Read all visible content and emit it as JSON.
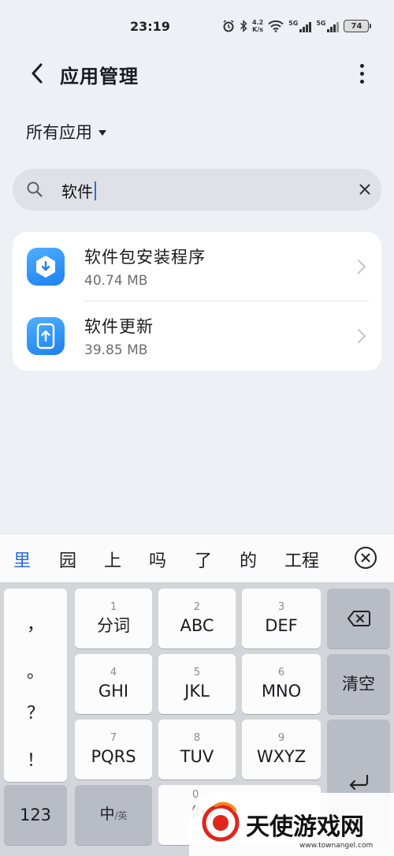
{
  "status_bar": {
    "time": "23:19",
    "net_speed_value": "4.2",
    "net_speed_unit": "K/s",
    "sim1_label": "5G",
    "sim2_label": "5G",
    "battery_level": "74"
  },
  "header": {
    "title": "应用管理"
  },
  "filter": {
    "label": "所有应用"
  },
  "search": {
    "value": "软件"
  },
  "results": [
    {
      "name": "软件包安装程序",
      "size": "40.74 MB",
      "icon": "package-installer-icon"
    },
    {
      "name": "软件更新",
      "size": "39.85 MB",
      "icon": "software-update-icon"
    }
  ],
  "candidates": [
    "里",
    "园",
    "上",
    "吗",
    "了",
    "的",
    "工程"
  ],
  "keyboard": {
    "punctuation": [
      "，",
      "。",
      "？",
      "！"
    ],
    "keys": [
      {
        "num": "1",
        "label": "分词"
      },
      {
        "num": "2",
        "label": "ABC"
      },
      {
        "num": "3",
        "label": "DEF"
      },
      {
        "num": "4",
        "label": "GHI"
      },
      {
        "num": "5",
        "label": "JKL"
      },
      {
        "num": "6",
        "label": "MNO"
      },
      {
        "num": "7",
        "label": "PQRS"
      },
      {
        "num": "8",
        "label": "TUV"
      },
      {
        "num": "9",
        "label": "WXYZ"
      }
    ],
    "clear_label": "清空",
    "num_mode_label": "123",
    "lang_label": "中",
    "lang_sub_label": "/英",
    "space_num": "0"
  },
  "watermark": {
    "text": "天使游戏网",
    "url": "www.townangel.com"
  },
  "colors": {
    "accent": "#2a6ad9",
    "background": "#eef0f5",
    "app_icon": "#2f8ff5"
  }
}
